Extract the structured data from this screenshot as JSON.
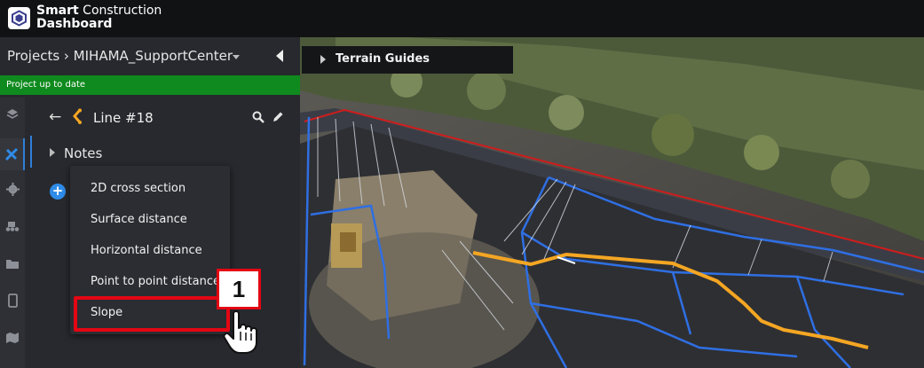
{
  "app": {
    "brand_bold": "Smart",
    "brand_rest": " Construction",
    "brand_line2": "Dashboard"
  },
  "project": {
    "breadcrumb": "Projects › MIHAMA_SupportCenter",
    "status": "Project up to date"
  },
  "detail": {
    "title": "Line #18",
    "notes_label": "Notes"
  },
  "menu": {
    "items": [
      "2D cross section",
      "Surface distance",
      "Horizontal distance",
      "Point to point distance",
      "Slope"
    ]
  },
  "callout": {
    "step_number": "1"
  },
  "map": {
    "panel_label": "Terrain Guides"
  },
  "colors": {
    "status_green": "#0f8a1e",
    "accent_blue": "#2f7fd8",
    "callout_red": "#e30613",
    "line_orange": "#f4a623"
  }
}
